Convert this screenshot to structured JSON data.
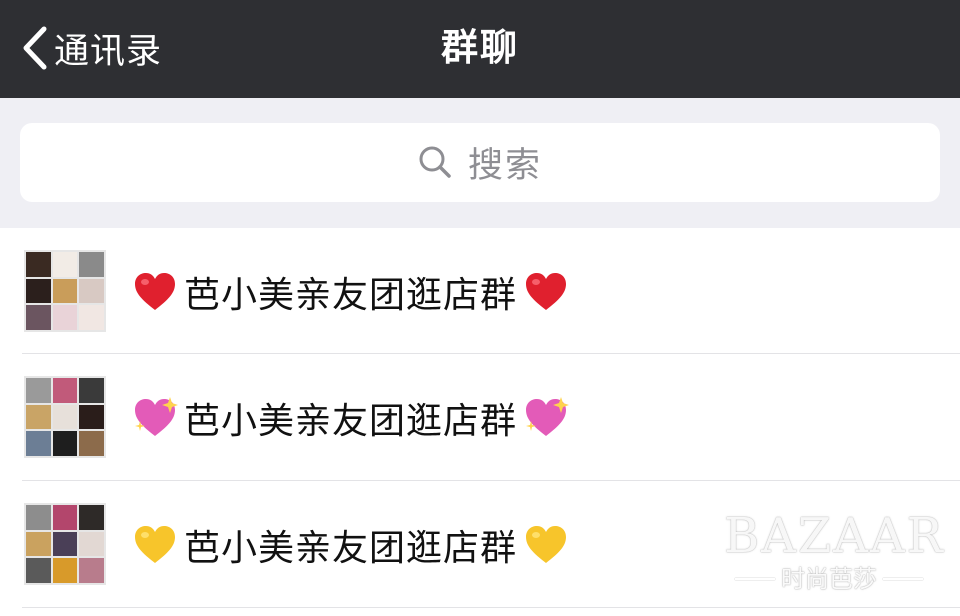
{
  "navbar": {
    "back_label": "通讯录",
    "title": "群聊",
    "background": "#2e2f33"
  },
  "search": {
    "placeholder": "搜索"
  },
  "groups": [
    {
      "name": "芭小美亲友团逛店群",
      "emoji": "red-heart",
      "emoji_color": "#e0202e"
    },
    {
      "name": "芭小美亲友团逛店群",
      "emoji": "sparkling-heart",
      "emoji_color": "#e35bb8"
    },
    {
      "name": "芭小美亲友团逛店群",
      "emoji": "yellow-heart",
      "emoji_color": "#f7c52b"
    }
  ],
  "watermark": {
    "logo": "BAZAAR",
    "subtitle": "时尚芭莎"
  }
}
